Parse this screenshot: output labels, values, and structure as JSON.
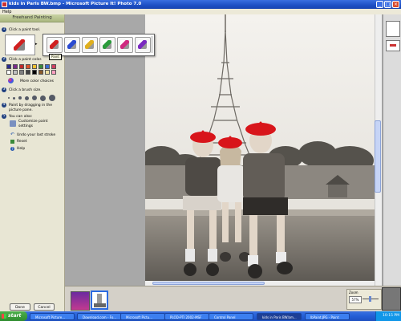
{
  "window": {
    "title": "kids in Paris BW.bmp - Microsoft Picture It! Photo 7.0",
    "menu": [
      "Help"
    ]
  },
  "left_pane": {
    "header": "Freehand Painting",
    "step1": "Click a paint tool.",
    "step2": "Click a paint color.",
    "more_colors": "More color choices",
    "step3": "Click a brush size.",
    "step4": "Paint by dragging in the picture pane.",
    "step5": "You can also:",
    "customize": "Customize paint settings",
    "undo": "Undo your last stroke",
    "reset": "Reset",
    "help": "Help",
    "done_button": "Done",
    "cancel_button": "Cancel",
    "colors": [
      "#2b2b8c",
      "#7a2a8a",
      "#c02a2a",
      "#e0532a",
      "#f0c030",
      "#3a8a3a",
      "#3a6ad0",
      "#d04060",
      "#ffffff",
      "#c0c0c0",
      "#808080",
      "#404040",
      "#000000",
      "#8a5a2a",
      "#f0e0a0",
      "#ffa0c0"
    ]
  },
  "tools_popup": {
    "tooltip": "Paint",
    "tools": [
      "paintbrush-red",
      "paintbrush-blue",
      "paintbrush-yellow",
      "paintbrush-green",
      "paintbrush-magenta",
      "paintbrush-purple"
    ]
  },
  "zoom": {
    "label": "Zoom",
    "value": "57%"
  },
  "taskbar": {
    "start": "start",
    "tasks": [
      "Microsoft Picture...",
      "Download.com - Fo...",
      "Microsoft Pictu...",
      "PLOD-PTI 2002-MSF",
      "Control Panel",
      "kids in Paris BW.bm...",
      "lbPaint.JPG - Paint"
    ],
    "active_index": 5,
    "clock": "10:15 PM"
  },
  "colors": {
    "title_bar": "#1d4fc4",
    "beret_red": "#d8151a",
    "taskbar": "#245ed6",
    "start_green": "#2e8b2e"
  }
}
